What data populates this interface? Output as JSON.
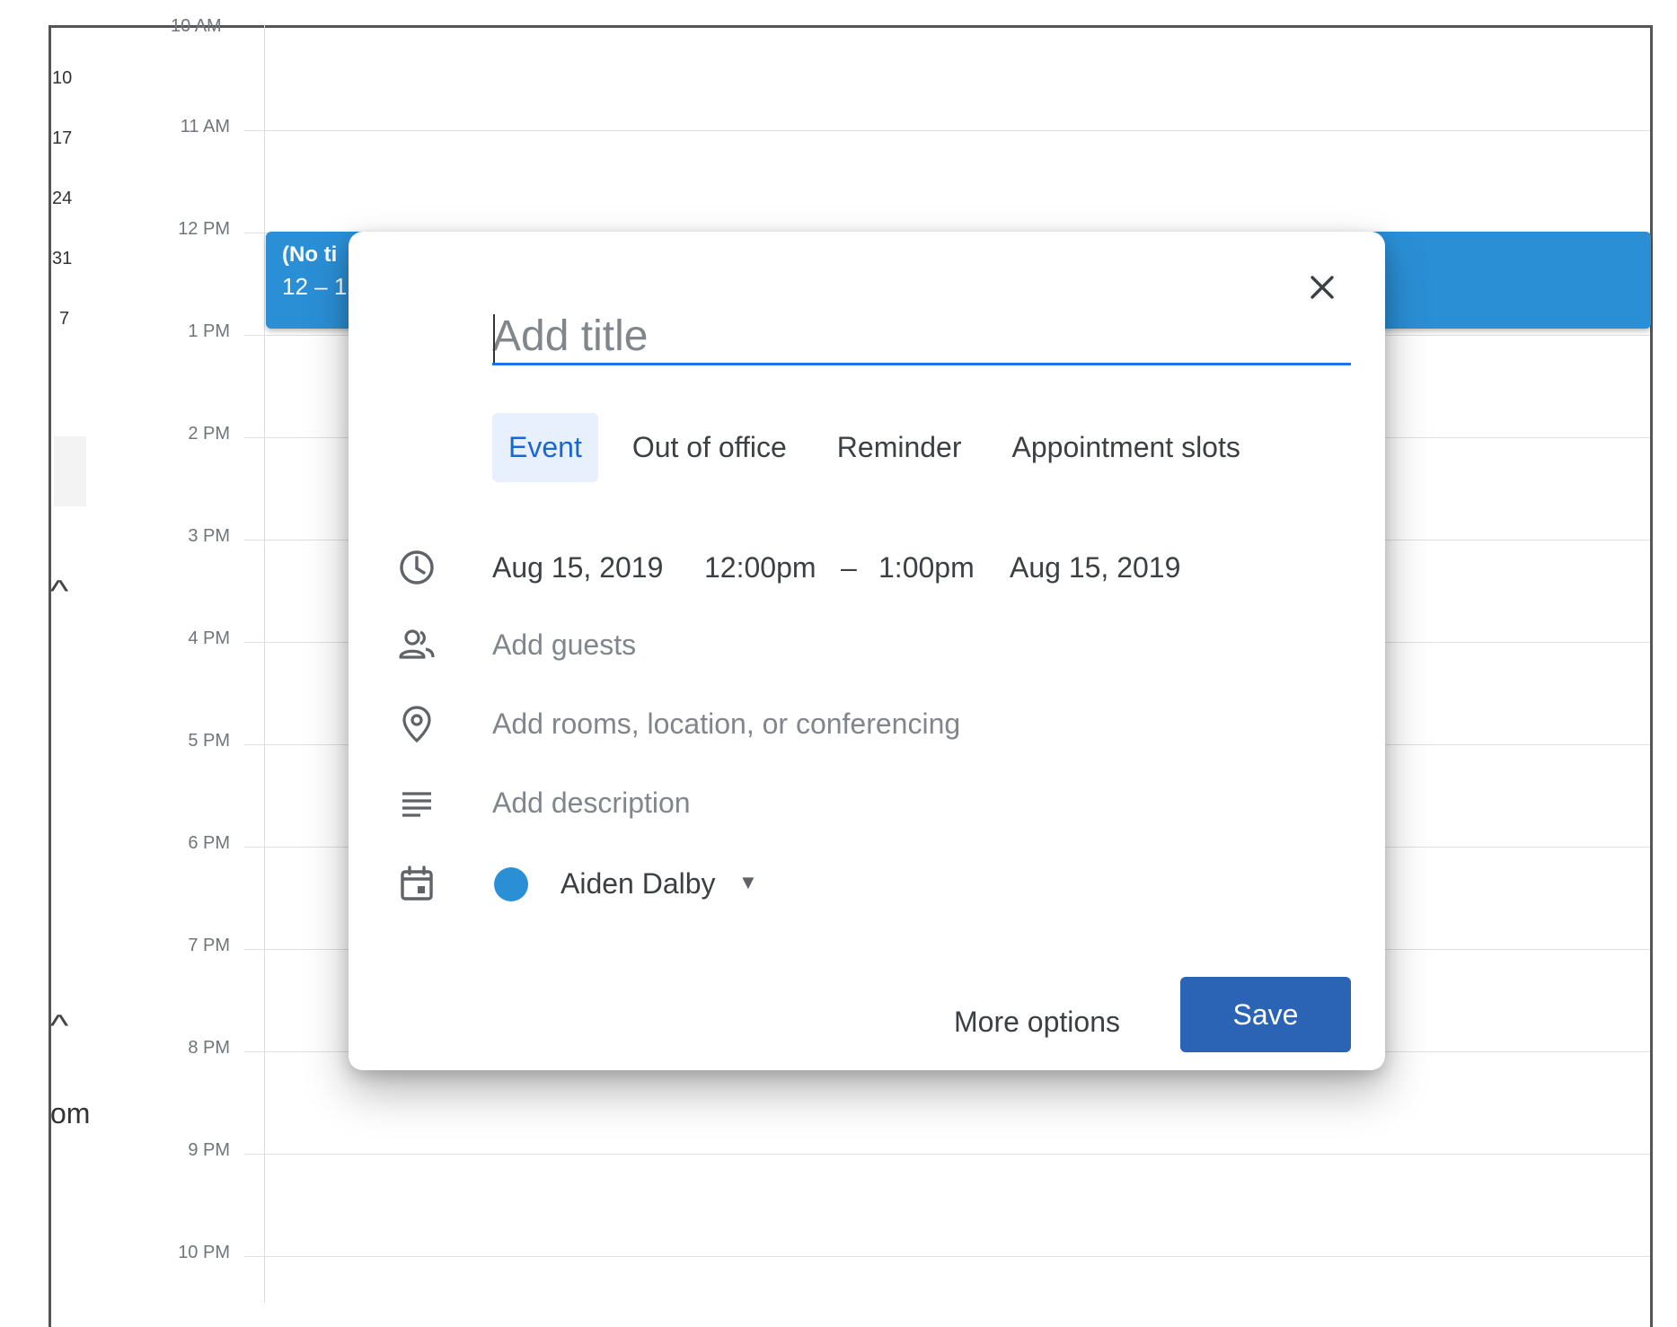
{
  "mini_calendar": {
    "dates": [
      "10",
      "17",
      "24",
      "31",
      "7"
    ],
    "partial_text": "om"
  },
  "timeline": {
    "top_clipped_label": "10 AM",
    "hours": [
      "11 AM",
      "12 PM",
      "1 PM",
      "2 PM",
      "3 PM",
      "4 PM",
      "5 PM",
      "6 PM",
      "7 PM",
      "8 PM",
      "9 PM",
      "10 PM"
    ]
  },
  "event_block": {
    "title": "(No ti",
    "time": "12 – 1"
  },
  "dialog": {
    "close_label": "×",
    "title_placeholder": "Add title",
    "tabs": [
      "Event",
      "Out of office",
      "Reminder",
      "Appointment slots"
    ],
    "active_tab": "Event",
    "datetime": {
      "start_date": "Aug 15, 2019",
      "start_time": "12:00pm",
      "separator": "–",
      "end_time": "1:00pm",
      "end_date": "Aug 15, 2019"
    },
    "guests_placeholder": "Add guests",
    "location_placeholder": "Add rooms, location, or conferencing",
    "description_placeholder": "Add description",
    "calendar": {
      "owner": "Aiden Dalby",
      "color": "#2b8fd6"
    },
    "more_options_label": "More options",
    "save_label": "Save"
  },
  "colors": {
    "accent": "#1a73e8",
    "save_button": "#2b64b5",
    "event_block": "#2b8fd6",
    "active_tab_bg": "#e8f0fe"
  }
}
